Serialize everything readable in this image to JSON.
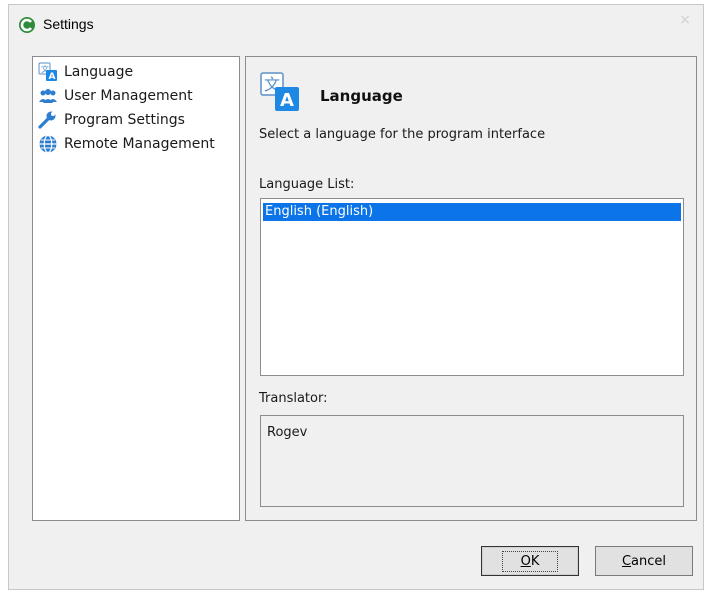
{
  "window": {
    "title": "Settings",
    "close_glyph": "×"
  },
  "nav": {
    "items": [
      {
        "label": "Language",
        "icon": "language-icon"
      },
      {
        "label": "User Management",
        "icon": "users-icon"
      },
      {
        "label": "Program Settings",
        "icon": "wrench-icon"
      },
      {
        "label": "Remote Management",
        "icon": "globe-icon"
      }
    ]
  },
  "content": {
    "title": "Language",
    "description": "Select a language for the program interface",
    "list_label": "Language List:",
    "languages": [
      "English (English)"
    ],
    "selected_language": "English (English)",
    "translator_label": "Translator:",
    "translator_value": "Rogev"
  },
  "buttons": {
    "ok_mnemonic": "O",
    "ok_rest": "K",
    "cancel_mnemonic": "C",
    "cancel_rest": "ancel"
  },
  "colors": {
    "selection": "#0a74e8",
    "accent_blue": "#1e88e5",
    "app_icon_green": "#2e8b3a"
  }
}
